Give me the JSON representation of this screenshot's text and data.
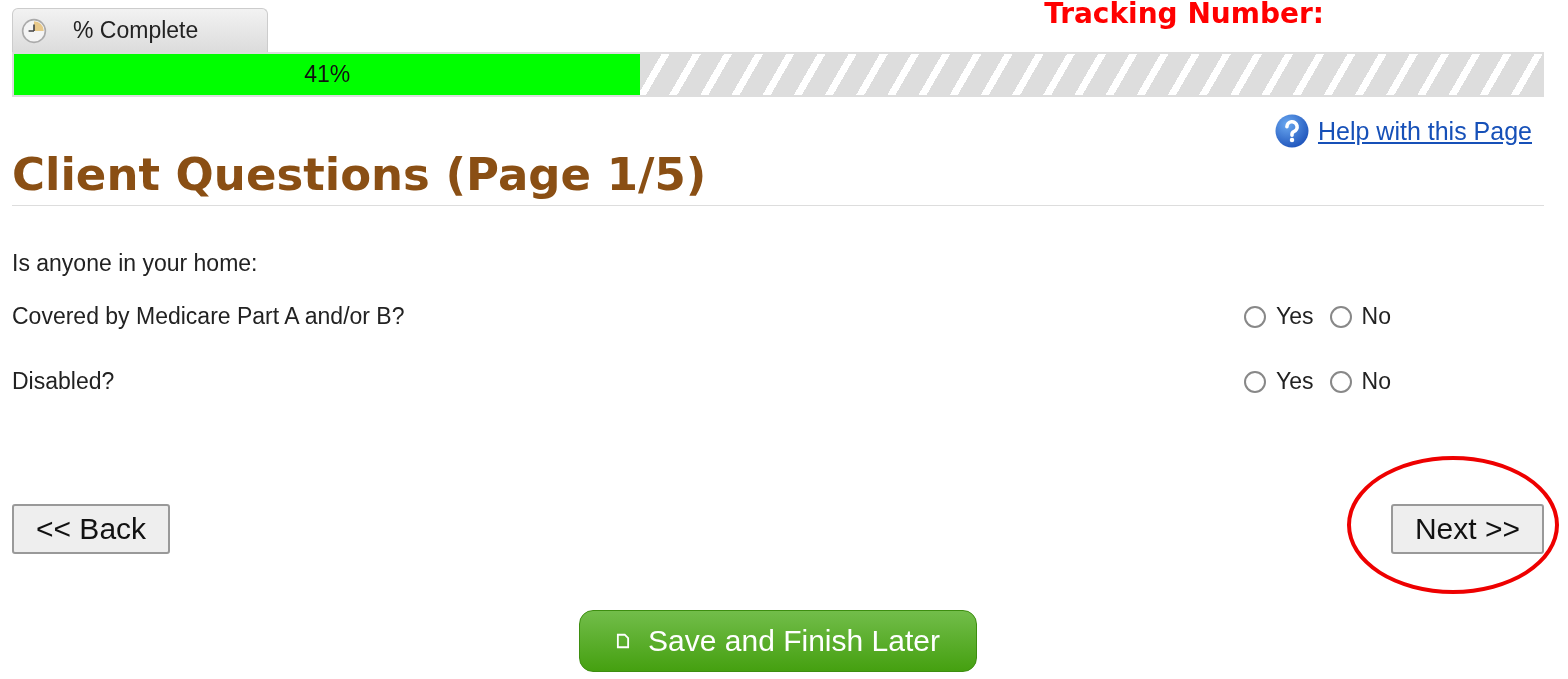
{
  "tracking_label": "Tracking Number:",
  "progress": {
    "tab_label": "% Complete",
    "level": 0.41,
    "reading": "41%"
  },
  "help_link": "Help with this Page",
  "heading": "Client Questions (Page 1/5)",
  "intro": "Is anyone in your home:",
  "questions": [
    {
      "text": "Covered by Medicare Part A and/or B?",
      "options": [
        {
          "label": "Yes",
          "selected": false
        },
        {
          "label": "No",
          "selected": false
        }
      ]
    },
    {
      "text": "Disabled?",
      "options": [
        {
          "label": "Yes",
          "selected": false
        },
        {
          "label": "No",
          "selected": false
        }
      ]
    }
  ],
  "back_button": {
    "label": "<< Back"
  },
  "next_button": {
    "label": "Next >>",
    "circled": true
  },
  "save_button": {
    "label": "Save and Finish Later"
  }
}
